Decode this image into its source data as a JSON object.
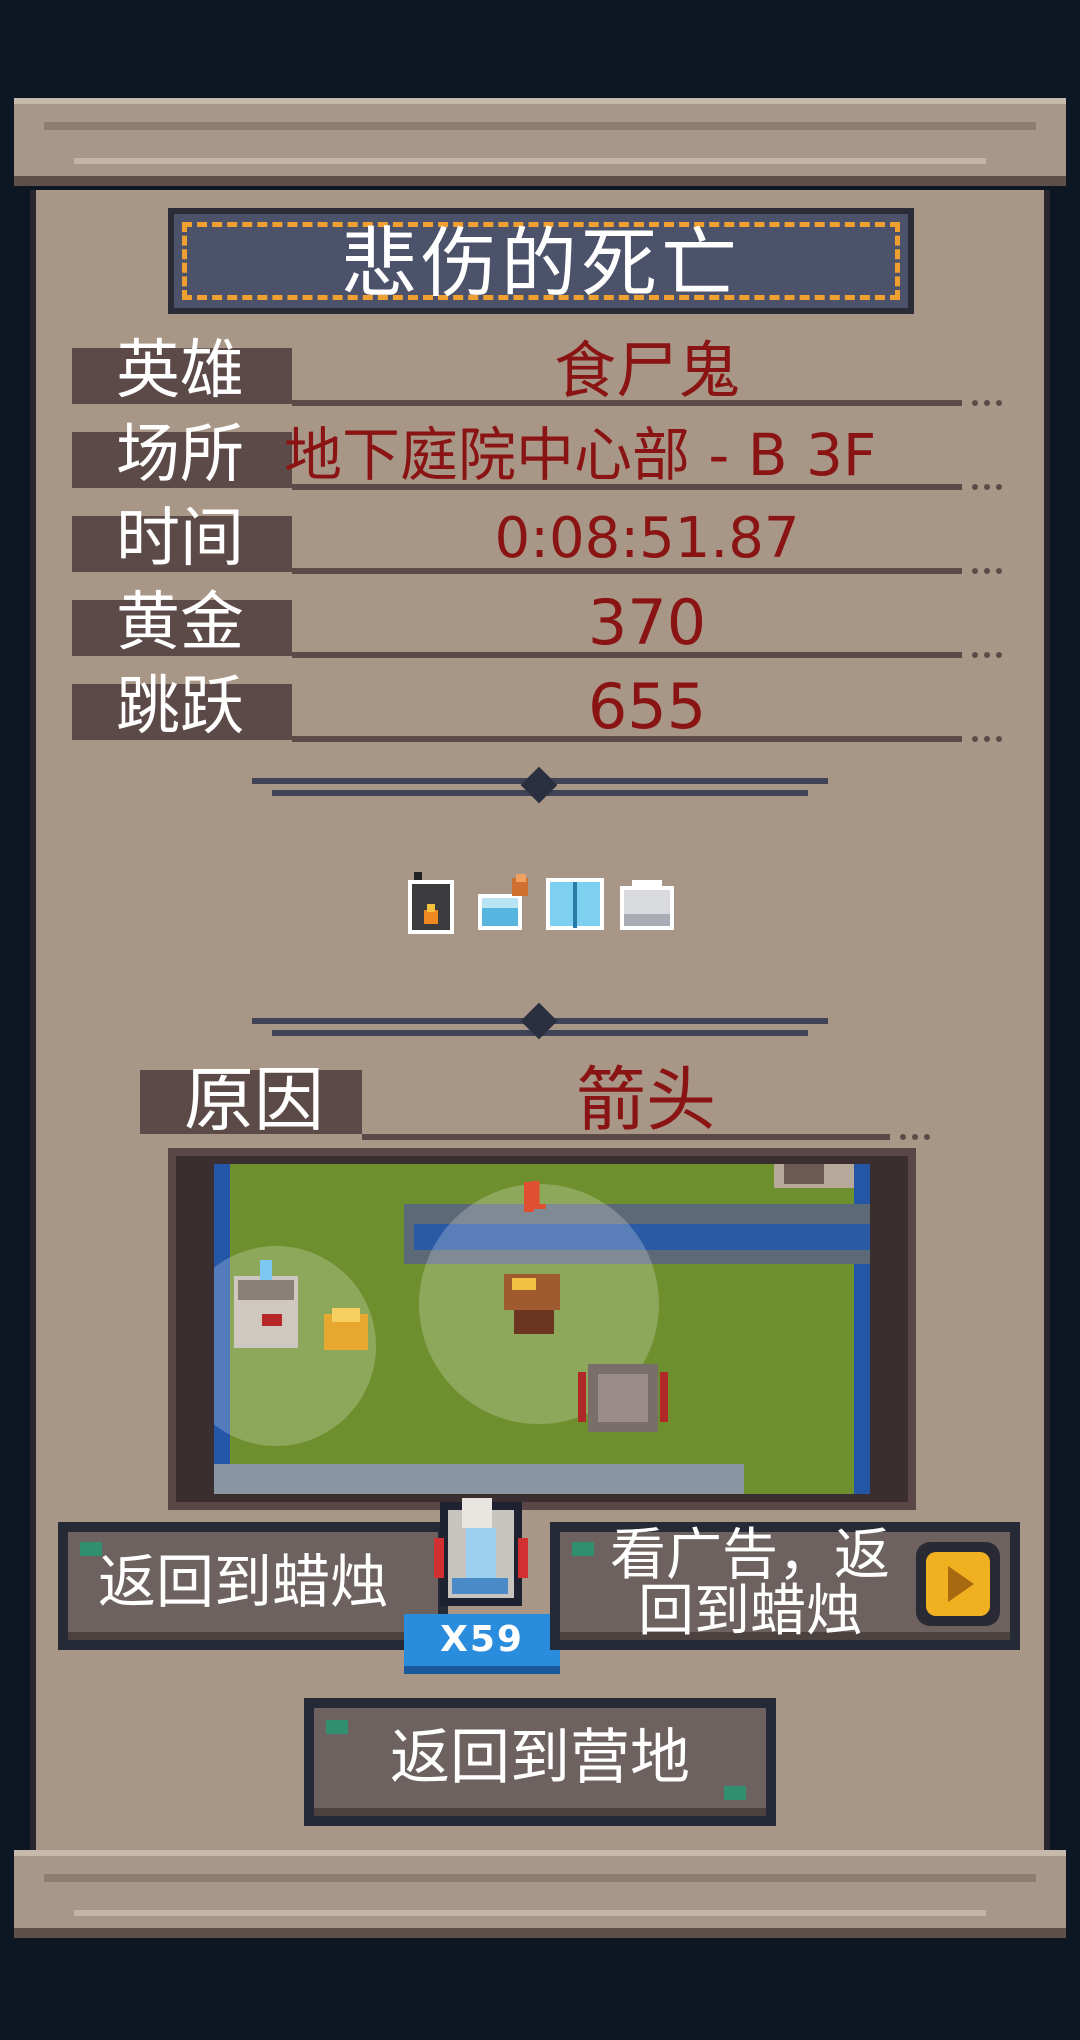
{
  "title": "悲伤的死亡",
  "stats": [
    {
      "label": "英雄",
      "value": "食尸鬼"
    },
    {
      "label": "场所",
      "value": "地下庭院中心部 - B 3F"
    },
    {
      "label": "时间",
      "value": "0:08:51.87"
    },
    {
      "label": "黄金",
      "value": "370"
    },
    {
      "label": "跳跃",
      "value": "655"
    }
  ],
  "items_icons": [
    "lantern-icon",
    "potion-icon",
    "book-icon",
    "stone-icon"
  ],
  "cause": {
    "label": "原因",
    "value": "箭头"
  },
  "scene": {
    "damage_number": "1"
  },
  "buttons": {
    "return_candle": "返回到蜡烛",
    "candle_count": "X59",
    "watch_ad_line1": "看广告，返",
    "watch_ad_line2": "回到蜡烛",
    "return_camp": "返回到营地"
  },
  "colors": {
    "background": "#0d1623",
    "parchment": "#a89686",
    "value_text": "#8a1414",
    "title_border": "#f0a030",
    "badge": "#2a8cdc"
  }
}
